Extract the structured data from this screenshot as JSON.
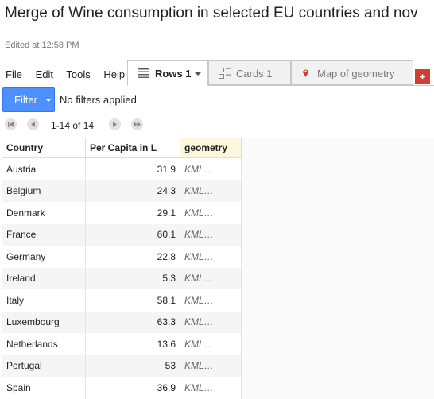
{
  "title": "Merge of Wine consumption in selected EU countries and nov",
  "edited": "Edited at 12:58 PM",
  "menu": [
    "File",
    "Edit",
    "Tools",
    "Help"
  ],
  "tabs": [
    {
      "label": "Rows 1",
      "icon": "rows-icon"
    },
    {
      "label": "Cards 1",
      "icon": "cards-icon"
    },
    {
      "label": "Map of geometry",
      "icon": "map-pin-icon"
    }
  ],
  "add_tab": "+",
  "filter": {
    "button": "Filter",
    "status": "No filters applied"
  },
  "pager": {
    "text": "1-14 of 14"
  },
  "table": {
    "headers": [
      "Country",
      "Per Capita in L",
      "geometry"
    ],
    "rows": [
      [
        "Austria",
        "31.9",
        "KML…"
      ],
      [
        "Belgium",
        "24.3",
        "KML…"
      ],
      [
        "Denmark",
        "29.1",
        "KML…"
      ],
      [
        "France",
        "60.1",
        "KML…"
      ],
      [
        "Germany",
        "22.8",
        "KML…"
      ],
      [
        "Ireland",
        "5.3",
        "KML…"
      ],
      [
        "Italy",
        "58.1",
        "KML…"
      ],
      [
        "Luxembourg",
        "63.3",
        "KML…"
      ],
      [
        "Netherlands",
        "13.6",
        "KML…"
      ],
      [
        "Portugal",
        "53",
        "KML…"
      ],
      [
        "Spain",
        "36.9",
        "KML…"
      ]
    ]
  },
  "colors": {
    "filter_blue": "#4d90fe",
    "add_red": "#d23f31",
    "geometry_header": "#fdf8dd"
  }
}
